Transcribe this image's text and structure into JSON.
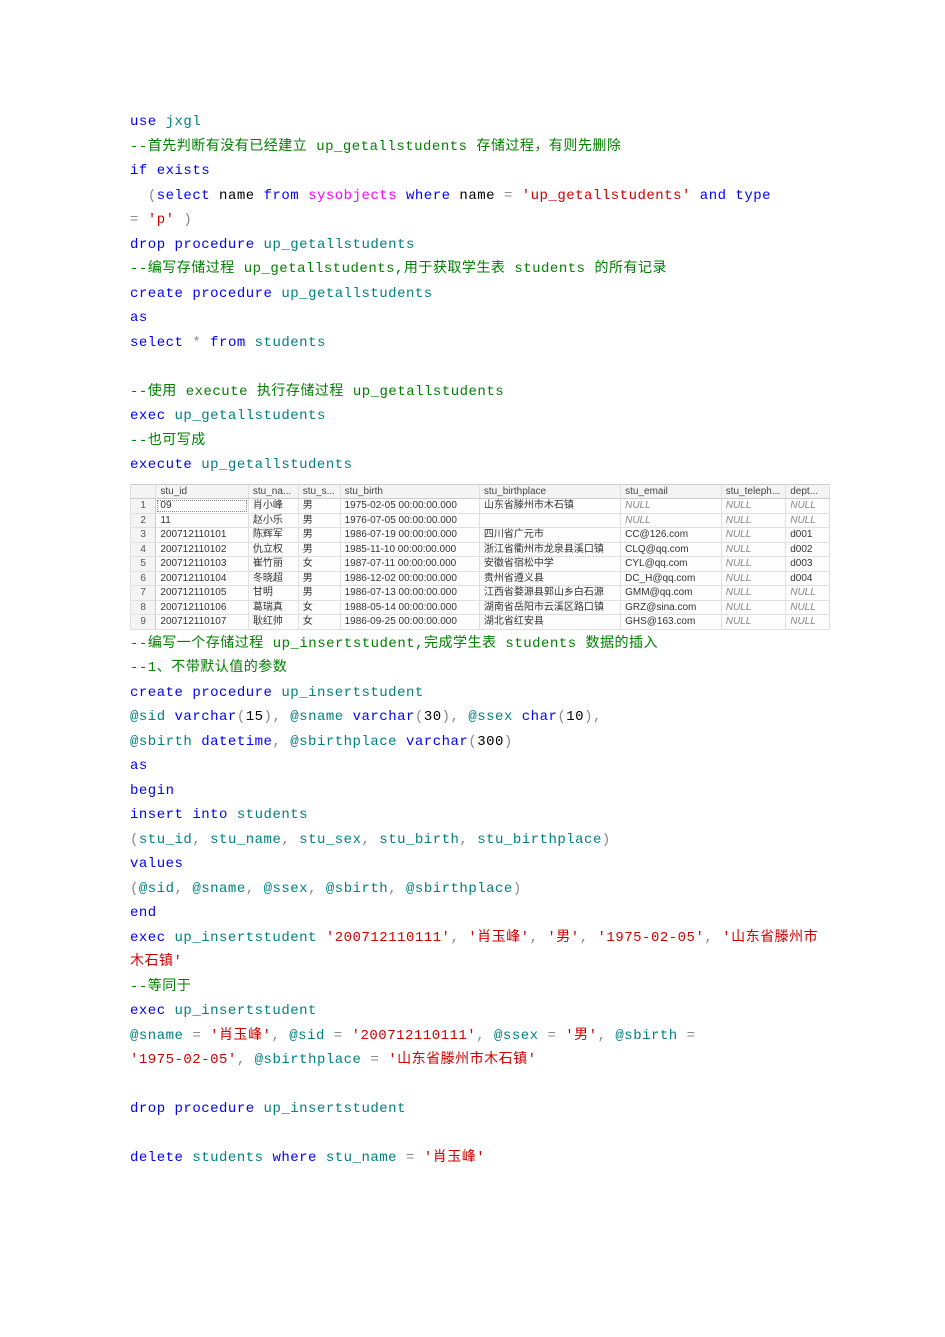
{
  "code_tokens": [
    {
      "t": "use",
      "c": "kw"
    },
    {
      "t": " ",
      "c": "plain"
    },
    {
      "t": "jxgl",
      "c": "ident"
    },
    {
      "t": "\n",
      "c": "plain"
    },
    {
      "t": "--首先判断有没有已经建立 up_getallstudents 存储过程，有则先删除",
      "c": "cmt"
    },
    {
      "t": "\n",
      "c": "plain"
    },
    {
      "t": "if",
      "c": "kw"
    },
    {
      "t": " ",
      "c": "plain"
    },
    {
      "t": "exists",
      "c": "kw"
    },
    {
      "t": "\n",
      "c": "plain"
    },
    {
      "t": "  (",
      "c": "op"
    },
    {
      "t": "select",
      "c": "kw"
    },
    {
      "t": " name ",
      "c": "plain"
    },
    {
      "t": "from",
      "c": "kw"
    },
    {
      "t": " ",
      "c": "plain"
    },
    {
      "t": "sysobjects",
      "c": "sysfunc"
    },
    {
      "t": " ",
      "c": "plain"
    },
    {
      "t": "where",
      "c": "kw"
    },
    {
      "t": " name ",
      "c": "plain"
    },
    {
      "t": "=",
      "c": "op"
    },
    {
      "t": " ",
      "c": "plain"
    },
    {
      "t": "'up_getallstudents'",
      "c": "str"
    },
    {
      "t": " ",
      "c": "plain"
    },
    {
      "t": "and",
      "c": "kw"
    },
    {
      "t": " ",
      "c": "plain"
    },
    {
      "t": "type",
      "c": "kw"
    },
    {
      "t": " ",
      "c": "plain"
    },
    {
      "t": "\n",
      "c": "plain"
    },
    {
      "t": "= ",
      "c": "op"
    },
    {
      "t": "'p'",
      "c": "str"
    },
    {
      "t": " )",
      "c": "op"
    },
    {
      "t": "\n",
      "c": "plain"
    },
    {
      "t": "drop",
      "c": "kw"
    },
    {
      "t": " ",
      "c": "plain"
    },
    {
      "t": "procedure",
      "c": "kw"
    },
    {
      "t": " ",
      "c": "plain"
    },
    {
      "t": "up_getallstudents",
      "c": "ident"
    },
    {
      "t": "\n",
      "c": "plain"
    },
    {
      "t": "--编写存储过程 up_getallstudents,用于获取学生表 students 的所有记录",
      "c": "cmt"
    },
    {
      "t": "\n",
      "c": "plain"
    },
    {
      "t": "create",
      "c": "kw"
    },
    {
      "t": " ",
      "c": "plain"
    },
    {
      "t": "procedure",
      "c": "kw"
    },
    {
      "t": " ",
      "c": "plain"
    },
    {
      "t": "up_getallstudents",
      "c": "ident"
    },
    {
      "t": "\n",
      "c": "plain"
    },
    {
      "t": "as",
      "c": "kw"
    },
    {
      "t": "\n",
      "c": "plain"
    },
    {
      "t": "select",
      "c": "kw"
    },
    {
      "t": " ",
      "c": "plain"
    },
    {
      "t": "*",
      "c": "op"
    },
    {
      "t": " ",
      "c": "plain"
    },
    {
      "t": "from",
      "c": "kw"
    },
    {
      "t": " ",
      "c": "plain"
    },
    {
      "t": "students",
      "c": "ident"
    },
    {
      "t": "\n",
      "c": "plain"
    },
    {
      "t": "\n",
      "c": "plain"
    },
    {
      "t": "--使用 execute 执行存储过程 up_getallstudents",
      "c": "cmt"
    },
    {
      "t": "\n",
      "c": "plain"
    },
    {
      "t": "exec",
      "c": "kw"
    },
    {
      "t": " ",
      "c": "plain"
    },
    {
      "t": "up_getallstudents",
      "c": "ident"
    },
    {
      "t": "\n",
      "c": "plain"
    },
    {
      "t": "--也可写成",
      "c": "cmt"
    },
    {
      "t": "\n",
      "c": "plain"
    },
    {
      "t": "execute",
      "c": "kw"
    },
    {
      "t": " ",
      "c": "plain"
    },
    {
      "t": "up_getallstudents",
      "c": "ident"
    }
  ],
  "table": {
    "headers": [
      "",
      "stu_id",
      "stu_na...",
      "stu_s...",
      "stu_birth",
      "stu_birthplace",
      "stu_email",
      "stu_teleph...",
      "dept..."
    ],
    "rows": [
      {
        "n": "1",
        "cells": [
          "09",
          "肖小峰",
          "男",
          "1975-02-05 00:00:00.000",
          "山东省滕州市木石镇",
          "NULL",
          "NULL",
          "NULL"
        ],
        "focus": true
      },
      {
        "n": "2",
        "cells": [
          "11",
          "赵小乐",
          "男",
          "1976-07-05 00:00:00.000",
          "",
          "NULL",
          "NULL",
          "NULL"
        ]
      },
      {
        "n": "3",
        "cells": [
          "200712110101",
          "陈辉军",
          "男",
          "1986-07-19 00:00:00.000",
          "四川省广元市",
          "CC@126.com",
          "NULL",
          "d001"
        ]
      },
      {
        "n": "4",
        "cells": [
          "200712110102",
          "仇立权",
          "男",
          "1985-11-10 00:00:00.000",
          "浙江省衢州市龙泉县溪口镇",
          "CLQ@qq.com",
          "NULL",
          "d002"
        ]
      },
      {
        "n": "5",
        "cells": [
          "200712110103",
          "崔竹丽",
          "女",
          "1987-07-11 00:00:00.000",
          "安徽省宿松中学",
          "CYL@qq.com",
          "NULL",
          "d003"
        ]
      },
      {
        "n": "6",
        "cells": [
          "200712110104",
          "冬晓超",
          "男",
          "1986-12-02 00:00:00.000",
          "贵州省遵义县",
          "DC_H@qq.com",
          "NULL",
          "d004"
        ]
      },
      {
        "n": "7",
        "cells": [
          "200712110105",
          "甘明",
          "男",
          "1986-07-13 00:00:00.000",
          "江西省婺源县郭山乡白石源",
          "GMM@qq.com",
          "NULL",
          "NULL"
        ]
      },
      {
        "n": "8",
        "cells": [
          "200712110106",
          "葛瑞真",
          "女",
          "1988-05-14 00:00:00.000",
          "湖南省岳阳市云溪区路口镇",
          "GRZ@sina.com",
          "NULL",
          "NULL"
        ]
      },
      {
        "n": "9",
        "cells": [
          "200712110107",
          "耿红帅",
          "女",
          "1986-09-25 00:00:00.000",
          "湖北省红安县",
          "GHS@163.com",
          "NULL",
          "NULL"
        ]
      }
    ]
  },
  "code_tokens_2": [
    {
      "t": "--编写一个存储过程 up_insertstudent,完成学生表 students 数据的插入",
      "c": "cmt"
    },
    {
      "t": "\n",
      "c": "plain"
    },
    {
      "t": "--1、不带默认值的参数",
      "c": "cmt"
    },
    {
      "t": "\n",
      "c": "plain"
    },
    {
      "t": "create",
      "c": "kw"
    },
    {
      "t": " ",
      "c": "plain"
    },
    {
      "t": "procedure",
      "c": "kw"
    },
    {
      "t": " ",
      "c": "plain"
    },
    {
      "t": "up_insertstudent",
      "c": "ident"
    },
    {
      "t": "\n",
      "c": "plain"
    },
    {
      "t": "@sid",
      "c": "ident"
    },
    {
      "t": " ",
      "c": "plain"
    },
    {
      "t": "varchar",
      "c": "kw"
    },
    {
      "t": "(",
      "c": "op"
    },
    {
      "t": "15",
      "c": "plain"
    },
    {
      "t": "),",
      "c": "op"
    },
    {
      "t": " ",
      "c": "plain"
    },
    {
      "t": "@sname",
      "c": "ident"
    },
    {
      "t": " ",
      "c": "plain"
    },
    {
      "t": "varchar",
      "c": "kw"
    },
    {
      "t": "(",
      "c": "op"
    },
    {
      "t": "30",
      "c": "plain"
    },
    {
      "t": "),",
      "c": "op"
    },
    {
      "t": " ",
      "c": "plain"
    },
    {
      "t": "@ssex",
      "c": "ident"
    },
    {
      "t": " ",
      "c": "plain"
    },
    {
      "t": "char",
      "c": "kw"
    },
    {
      "t": "(",
      "c": "op"
    },
    {
      "t": "10",
      "c": "plain"
    },
    {
      "t": "),",
      "c": "op"
    },
    {
      "t": "\n",
      "c": "plain"
    },
    {
      "t": "@sbirth",
      "c": "ident"
    },
    {
      "t": " ",
      "c": "plain"
    },
    {
      "t": "datetime",
      "c": "kw"
    },
    {
      "t": ",",
      "c": "op"
    },
    {
      "t": " ",
      "c": "plain"
    },
    {
      "t": "@sbirthplace",
      "c": "ident"
    },
    {
      "t": " ",
      "c": "plain"
    },
    {
      "t": "varchar",
      "c": "kw"
    },
    {
      "t": "(",
      "c": "op"
    },
    {
      "t": "300",
      "c": "plain"
    },
    {
      "t": ")",
      "c": "op"
    },
    {
      "t": "\n",
      "c": "plain"
    },
    {
      "t": "as",
      "c": "kw"
    },
    {
      "t": "\n",
      "c": "plain"
    },
    {
      "t": "begin",
      "c": "kw"
    },
    {
      "t": "\n",
      "c": "plain"
    },
    {
      "t": "insert",
      "c": "kw"
    },
    {
      "t": " ",
      "c": "plain"
    },
    {
      "t": "into",
      "c": "kw"
    },
    {
      "t": " ",
      "c": "plain"
    },
    {
      "t": "students",
      "c": "ident"
    },
    {
      "t": "\n",
      "c": "plain"
    },
    {
      "t": "(",
      "c": "op"
    },
    {
      "t": "stu_id",
      "c": "ident"
    },
    {
      "t": ",",
      "c": "op"
    },
    {
      "t": " ",
      "c": "plain"
    },
    {
      "t": "stu_name",
      "c": "ident"
    },
    {
      "t": ",",
      "c": "op"
    },
    {
      "t": " ",
      "c": "plain"
    },
    {
      "t": "stu_sex",
      "c": "ident"
    },
    {
      "t": ",",
      "c": "op"
    },
    {
      "t": " ",
      "c": "plain"
    },
    {
      "t": "stu_birth",
      "c": "ident"
    },
    {
      "t": ",",
      "c": "op"
    },
    {
      "t": " ",
      "c": "plain"
    },
    {
      "t": "stu_birthplace",
      "c": "ident"
    },
    {
      "t": ")",
      "c": "op"
    },
    {
      "t": "\n",
      "c": "plain"
    },
    {
      "t": "values",
      "c": "kw"
    },
    {
      "t": "\n",
      "c": "plain"
    },
    {
      "t": "(",
      "c": "op"
    },
    {
      "t": "@sid",
      "c": "ident"
    },
    {
      "t": ",",
      "c": "op"
    },
    {
      "t": " ",
      "c": "plain"
    },
    {
      "t": "@sname",
      "c": "ident"
    },
    {
      "t": ",",
      "c": "op"
    },
    {
      "t": " ",
      "c": "plain"
    },
    {
      "t": "@ssex",
      "c": "ident"
    },
    {
      "t": ",",
      "c": "op"
    },
    {
      "t": " ",
      "c": "plain"
    },
    {
      "t": "@sbirth",
      "c": "ident"
    },
    {
      "t": ",",
      "c": "op"
    },
    {
      "t": " ",
      "c": "plain"
    },
    {
      "t": "@sbirthplace",
      "c": "ident"
    },
    {
      "t": ")",
      "c": "op"
    },
    {
      "t": "\n",
      "c": "plain"
    },
    {
      "t": "end",
      "c": "kw"
    },
    {
      "t": "\n",
      "c": "plain"
    },
    {
      "t": "exec",
      "c": "kw"
    },
    {
      "t": " ",
      "c": "plain"
    },
    {
      "t": "up_insertstudent",
      "c": "ident"
    },
    {
      "t": " ",
      "c": "plain"
    },
    {
      "t": "'200712110111'",
      "c": "str"
    },
    {
      "t": ",",
      "c": "op"
    },
    {
      "t": " ",
      "c": "plain"
    },
    {
      "t": "'肖玉峰'",
      "c": "str"
    },
    {
      "t": ",",
      "c": "op"
    },
    {
      "t": " ",
      "c": "plain"
    },
    {
      "t": "'男'",
      "c": "str"
    },
    {
      "t": ",",
      "c": "op"
    },
    {
      "t": " ",
      "c": "plain"
    },
    {
      "t": "'1975-02-05'",
      "c": "str"
    },
    {
      "t": ",",
      "c": "op"
    },
    {
      "t": " ",
      "c": "plain"
    },
    {
      "t": "'山东省滕州市木石镇'",
      "c": "str"
    },
    {
      "t": "\n",
      "c": "plain"
    },
    {
      "t": "--等同于",
      "c": "cmt"
    },
    {
      "t": "\n",
      "c": "plain"
    },
    {
      "t": "exec",
      "c": "kw"
    },
    {
      "t": " ",
      "c": "plain"
    },
    {
      "t": "up_insertstudent",
      "c": "ident"
    },
    {
      "t": "\n",
      "c": "plain"
    },
    {
      "t": "@sname",
      "c": "ident"
    },
    {
      "t": " ",
      "c": "plain"
    },
    {
      "t": "=",
      "c": "op"
    },
    {
      "t": " ",
      "c": "plain"
    },
    {
      "t": "'肖玉峰'",
      "c": "str"
    },
    {
      "t": ",",
      "c": "op"
    },
    {
      "t": " ",
      "c": "plain"
    },
    {
      "t": "@sid",
      "c": "ident"
    },
    {
      "t": " ",
      "c": "plain"
    },
    {
      "t": "=",
      "c": "op"
    },
    {
      "t": " ",
      "c": "plain"
    },
    {
      "t": "'200712110111'",
      "c": "str"
    },
    {
      "t": ",",
      "c": "op"
    },
    {
      "t": " ",
      "c": "plain"
    },
    {
      "t": "@ssex",
      "c": "ident"
    },
    {
      "t": " ",
      "c": "plain"
    },
    {
      "t": "=",
      "c": "op"
    },
    {
      "t": " ",
      "c": "plain"
    },
    {
      "t": "'男'",
      "c": "str"
    },
    {
      "t": ",",
      "c": "op"
    },
    {
      "t": " ",
      "c": "plain"
    },
    {
      "t": "@sbirth",
      "c": "ident"
    },
    {
      "t": " ",
      "c": "plain"
    },
    {
      "t": "=",
      "c": "op"
    },
    {
      "t": " ",
      "c": "plain"
    },
    {
      "t": "\n",
      "c": "plain"
    },
    {
      "t": "'1975-02-05'",
      "c": "str"
    },
    {
      "t": ",",
      "c": "op"
    },
    {
      "t": " ",
      "c": "plain"
    },
    {
      "t": "@sbirthplace",
      "c": "ident"
    },
    {
      "t": " ",
      "c": "plain"
    },
    {
      "t": "=",
      "c": "op"
    },
    {
      "t": " ",
      "c": "plain"
    },
    {
      "t": "'山东省滕州市木石镇'",
      "c": "str"
    },
    {
      "t": "\n",
      "c": "plain"
    },
    {
      "t": "\n",
      "c": "plain"
    },
    {
      "t": "drop",
      "c": "kw"
    },
    {
      "t": " ",
      "c": "plain"
    },
    {
      "t": "procedure",
      "c": "kw"
    },
    {
      "t": " ",
      "c": "plain"
    },
    {
      "t": "up_insertstudent",
      "c": "ident"
    },
    {
      "t": "\n",
      "c": "plain"
    },
    {
      "t": "\n",
      "c": "plain"
    },
    {
      "t": "delete",
      "c": "kw"
    },
    {
      "t": " ",
      "c": "plain"
    },
    {
      "t": "students",
      "c": "ident"
    },
    {
      "t": " ",
      "c": "plain"
    },
    {
      "t": "where",
      "c": "kw"
    },
    {
      "t": " ",
      "c": "plain"
    },
    {
      "t": "stu_name",
      "c": "ident"
    },
    {
      "t": " ",
      "c": "plain"
    },
    {
      "t": "=",
      "c": "op"
    },
    {
      "t": " ",
      "c": "plain"
    },
    {
      "t": "'肖玉峰'",
      "c": "str"
    }
  ]
}
